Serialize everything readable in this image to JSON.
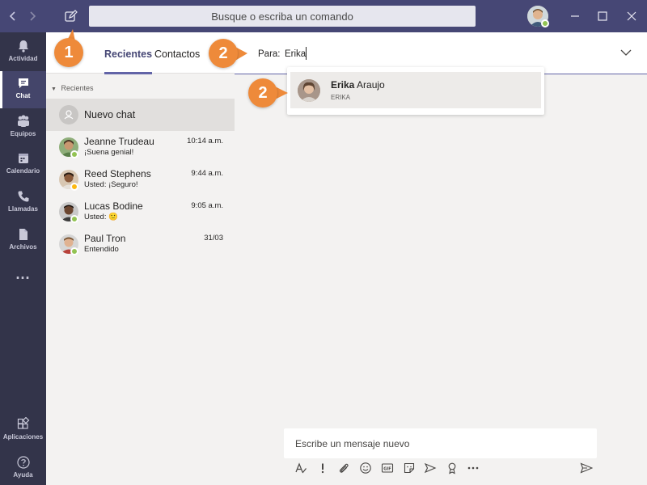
{
  "titlebar": {
    "search_placeholder": "Busque o escriba un comando",
    "back_icon": "chevron-left-icon",
    "forward_icon": "chevron-right-icon",
    "compose_icon": "compose-icon",
    "window_buttons": [
      "minimize",
      "maximize",
      "close"
    ]
  },
  "rail": {
    "items": [
      {
        "label": "Actividad",
        "icon": "bell-icon"
      },
      {
        "label": "Chat",
        "icon": "chat-icon",
        "active": true
      },
      {
        "label": "Equipos",
        "icon": "teams-icon"
      },
      {
        "label": "Calendario",
        "icon": "calendar-icon"
      },
      {
        "label": "Llamadas",
        "icon": "phone-icon"
      },
      {
        "label": "Archivos",
        "icon": "file-icon"
      },
      {
        "label": "...",
        "icon": "more-icon"
      }
    ],
    "bottom_items": [
      {
        "label": "Aplicaciones",
        "icon": "apps-icon"
      },
      {
        "label": "Ayuda",
        "icon": "help-icon"
      }
    ]
  },
  "list": {
    "tabs": [
      "Recientes",
      "Contactos"
    ],
    "section_header": "Recientes",
    "new_chat_label": "Nuevo chat",
    "chats": [
      {
        "name": "Jeanne Trudeau",
        "preview": "¡Suena genial!",
        "time": "10:14 a.m.",
        "status": "available"
      },
      {
        "name": "Reed Stephens",
        "preview": "Usted: ¡Seguro!",
        "time": "9:44 a.m.",
        "status": "away"
      },
      {
        "name": "Lucas Bodine",
        "preview": "Usted: 🙂",
        "time": "9:05 a.m.",
        "status": "available"
      },
      {
        "name": "Paul Tron",
        "preview": "Entendido",
        "time": "31/03",
        "status": "available"
      }
    ]
  },
  "main": {
    "to_label": "Para:",
    "to_value": "Erika",
    "suggestion": {
      "first": "Erika",
      "last": " Araujo",
      "sub": "ERIKA"
    },
    "composer_placeholder": "Escribe un mensaje nuevo",
    "toolbar": [
      "format-icon",
      "important-icon",
      "attach-icon",
      "emoji-icon",
      "gif-icon",
      "sticker-icon",
      "meet-icon",
      "praise-icon",
      "more-icon",
      "send-icon"
    ]
  },
  "callouts": {
    "one": "1",
    "two_a": "2",
    "two_b": "2"
  },
  "colors": {
    "titlebar": "#464775",
    "rail": "#33344a",
    "accent": "#6264a7",
    "callout": "#ee8a3a",
    "available": "#92c353",
    "away": "#fdb913"
  }
}
